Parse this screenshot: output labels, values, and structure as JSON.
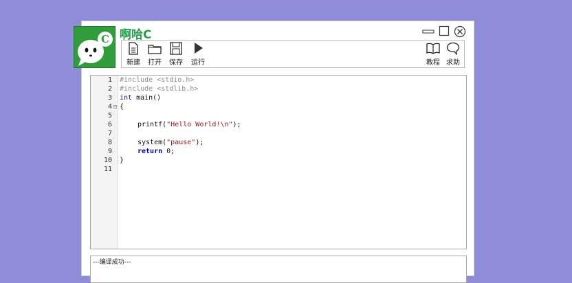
{
  "app": {
    "title": "啊哈C",
    "logo_letter": "C",
    "accent_color": "#22a34a",
    "background_color": "#8f8cd8"
  },
  "window_controls": {
    "minimize_icon": "minimize-icon",
    "maximize_icon": "maximize-icon",
    "close_icon": "close-icon"
  },
  "toolbar": {
    "new_label": "新建",
    "open_label": "打开",
    "save_label": "保存",
    "run_label": "运行",
    "tutorial_label": "教程",
    "help_label": "求助"
  },
  "editor": {
    "line_numbers": [
      "1",
      "2",
      "3",
      "4",
      "5",
      "6",
      "7",
      "8",
      "9",
      "10",
      "11"
    ],
    "code": {
      "l1": "#include <stdio.h>",
      "l2": "#include <stdlib.h>",
      "l3_kw": "int",
      "l3_rest": " main()",
      "l4": "{",
      "l6_fn": "printf(",
      "l6_str": "\"Hello World!\\n\"",
      "l6_end": ");",
      "l8_fn": "system(",
      "l8_str": "\"pause\"",
      "l8_end": ");",
      "l9_kw": "return",
      "l9_rest": " 0;",
      "l10": "}"
    }
  },
  "status": {
    "message": "---编译成功---"
  }
}
